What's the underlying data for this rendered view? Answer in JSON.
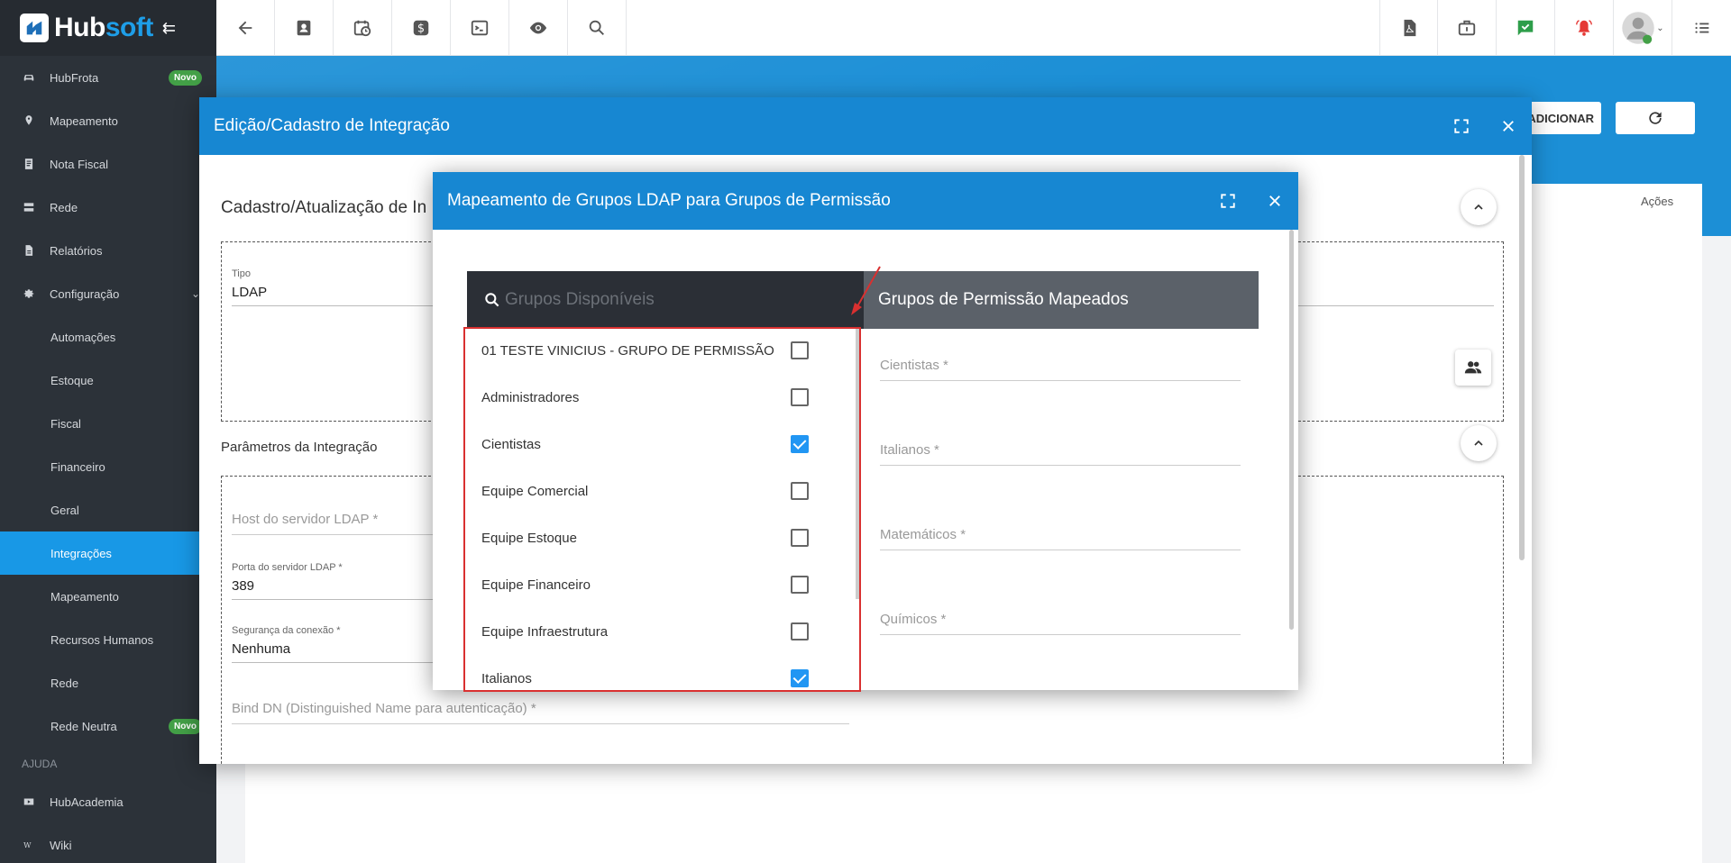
{
  "brand": {
    "name_part1": "Hub",
    "name_part2": "soft"
  },
  "sidebar": {
    "items": [
      {
        "label": "HubFrota",
        "icon": "car-icon",
        "badge": "Novo"
      },
      {
        "label": "Mapeamento",
        "icon": "map-pin-icon"
      },
      {
        "label": "Nota Fiscal",
        "icon": "receipt-icon"
      },
      {
        "label": "Rede",
        "icon": "server-icon"
      },
      {
        "label": "Relatórios",
        "icon": "file-icon"
      },
      {
        "label": "Configuração",
        "icon": "gear-icon",
        "expanded": true
      }
    ],
    "sub_items": [
      {
        "label": "Automações"
      },
      {
        "label": "Estoque"
      },
      {
        "label": "Fiscal"
      },
      {
        "label": "Financeiro"
      },
      {
        "label": "Geral"
      },
      {
        "label": "Integrações",
        "active": true
      },
      {
        "label": "Mapeamento"
      },
      {
        "label": "Recursos Humanos"
      },
      {
        "label": "Rede"
      },
      {
        "label": "Rede Neutra",
        "badge": "Novo"
      }
    ],
    "help_label": "AJUDA",
    "help_items": [
      {
        "label": "HubAcademia",
        "icon": "youtube-icon"
      },
      {
        "label": "Wiki",
        "icon": "wikipedia-icon"
      }
    ]
  },
  "page": {
    "add_button": "ADICIONAR",
    "actions_column": "Ações"
  },
  "modal1": {
    "title": "Edição/Cadastro de Integração",
    "section1_title": "Cadastro/Atualização de In",
    "tipo_label": "Tipo",
    "tipo_value": "LDAP",
    "section2_title": "Parâmetros da Integração",
    "host_placeholder": "Host do servidor LDAP *",
    "port_label": "Porta do servidor LDAP *",
    "port_value": "389",
    "security_label": "Segurança da conexão *",
    "security_value": "Nenhuma",
    "bind_dn_placeholder": "Bind DN (Distinguished Name para autenticação) *"
  },
  "modal2": {
    "title": "Mapeamento de Grupos LDAP para Grupos de Permissão",
    "search_placeholder": "Grupos Disponíveis",
    "mapped_title": "Grupos de Permissão Mapeados",
    "groups": [
      {
        "label": "01 TESTE VINICIUS - GRUPO DE PERMISSÃO",
        "checked": false
      },
      {
        "label": "Administradores",
        "checked": false
      },
      {
        "label": "Cientistas",
        "checked": true
      },
      {
        "label": "Equipe Comercial",
        "checked": false
      },
      {
        "label": "Equipe Estoque",
        "checked": false
      },
      {
        "label": "Equipe Financeiro",
        "checked": false
      },
      {
        "label": "Equipe Infraestrutura",
        "checked": false
      },
      {
        "label": "Italianos",
        "checked": true
      }
    ],
    "mapped_fields": [
      {
        "label": "Cientistas *"
      },
      {
        "label": "Italianos *"
      },
      {
        "label": "Matemáticos *"
      },
      {
        "label": "Químicos *"
      }
    ]
  },
  "colors": {
    "primary": "#1787d2",
    "sidebar_bg": "#2c3239",
    "active": "#1898e6",
    "highlight": "#d93030",
    "checkbox": "#2196f3"
  }
}
